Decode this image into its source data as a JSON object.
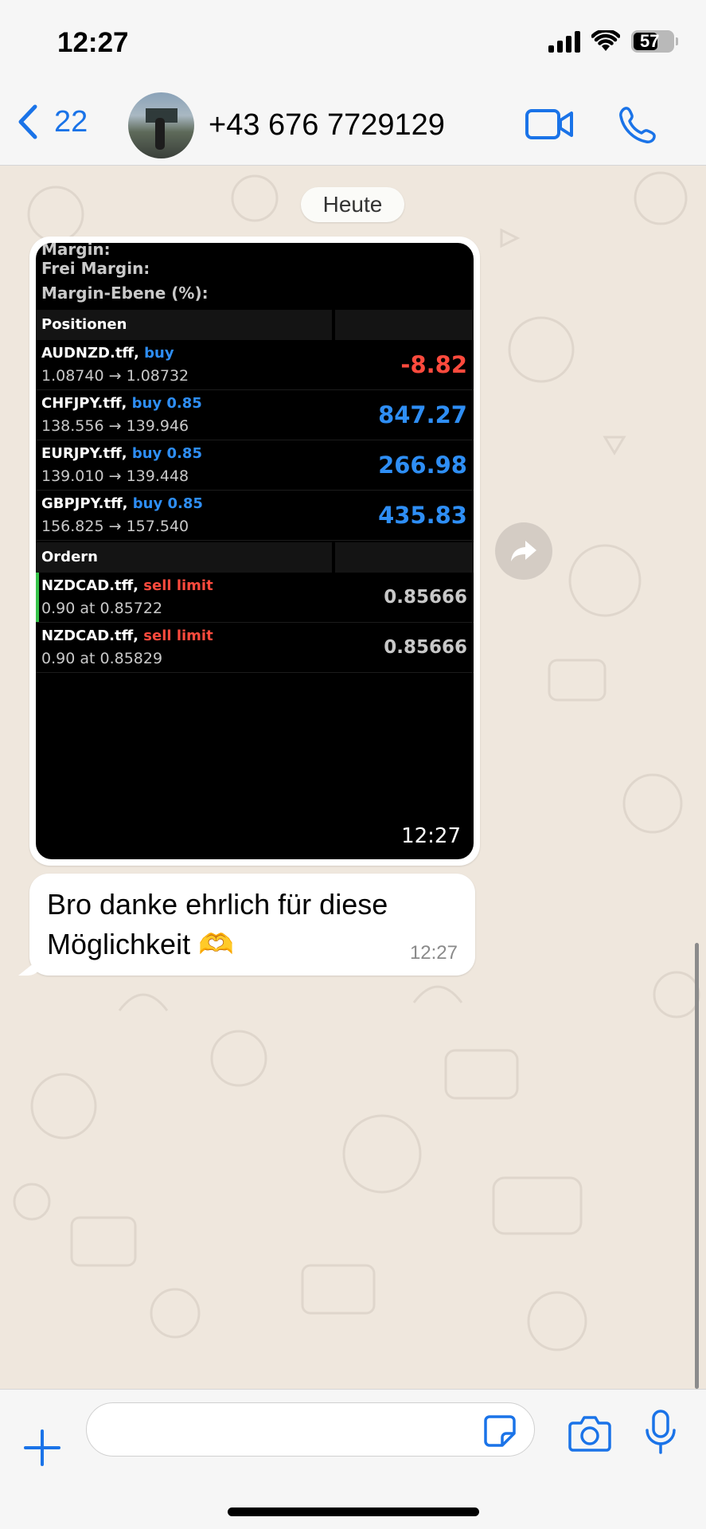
{
  "status_bar": {
    "time": "12:27",
    "battery_level": "57"
  },
  "header": {
    "back_count": "22",
    "contact_name": "+43 676 7729129",
    "icons": [
      "chevron-left-icon",
      "video-camera-icon",
      "phone-icon"
    ],
    "accent_color": "#1a73e8"
  },
  "chat": {
    "date_label": "Heute",
    "image_message": {
      "time": "12:27",
      "account": {
        "margin_label": "Margin:",
        "free_margin_label": "Frei Margin:",
        "margin_level_label": "Margin-Ebene (%):"
      },
      "positions_header": "Positionen",
      "positions": [
        {
          "symbol": "AUDNZD.tff,",
          "side": "buy",
          "prices": "1.08740 → 1.08732",
          "profit": "-8.82"
        },
        {
          "symbol": "CHFJPY.tff,",
          "side": "buy 0.85",
          "prices": "138.556 → 139.946",
          "profit": "847.27"
        },
        {
          "symbol": "EURJPY.tff,",
          "side": "buy 0.85",
          "prices": "139.010 → 139.448",
          "profit": "266.98"
        },
        {
          "symbol": "GBPJPY.tff,",
          "side": "buy 0.85",
          "prices": "156.825 → 157.540",
          "profit": "435.83"
        }
      ],
      "orders_header": "Ordern",
      "orders": [
        {
          "symbol": "NZDCAD.tff,",
          "side": "sell limit",
          "detail": "0.90 at 0.85722",
          "price": "0.85666"
        },
        {
          "symbol": "NZDCAD.tff,",
          "side": "sell limit",
          "detail": "0.90 at 0.85829",
          "price": "0.85666"
        }
      ],
      "colors": {
        "buy": "#2e8ef5",
        "sell": "#ff4a3d",
        "order_marker": "#36c24a"
      }
    },
    "text_message": {
      "text": "Bro danke ehrlich für diese Möglichkeit 🫶",
      "time": "12:27"
    }
  },
  "composer": {
    "placeholder": "",
    "icons": [
      "plus-icon",
      "sticker-icon",
      "camera-icon",
      "microphone-icon"
    ]
  }
}
